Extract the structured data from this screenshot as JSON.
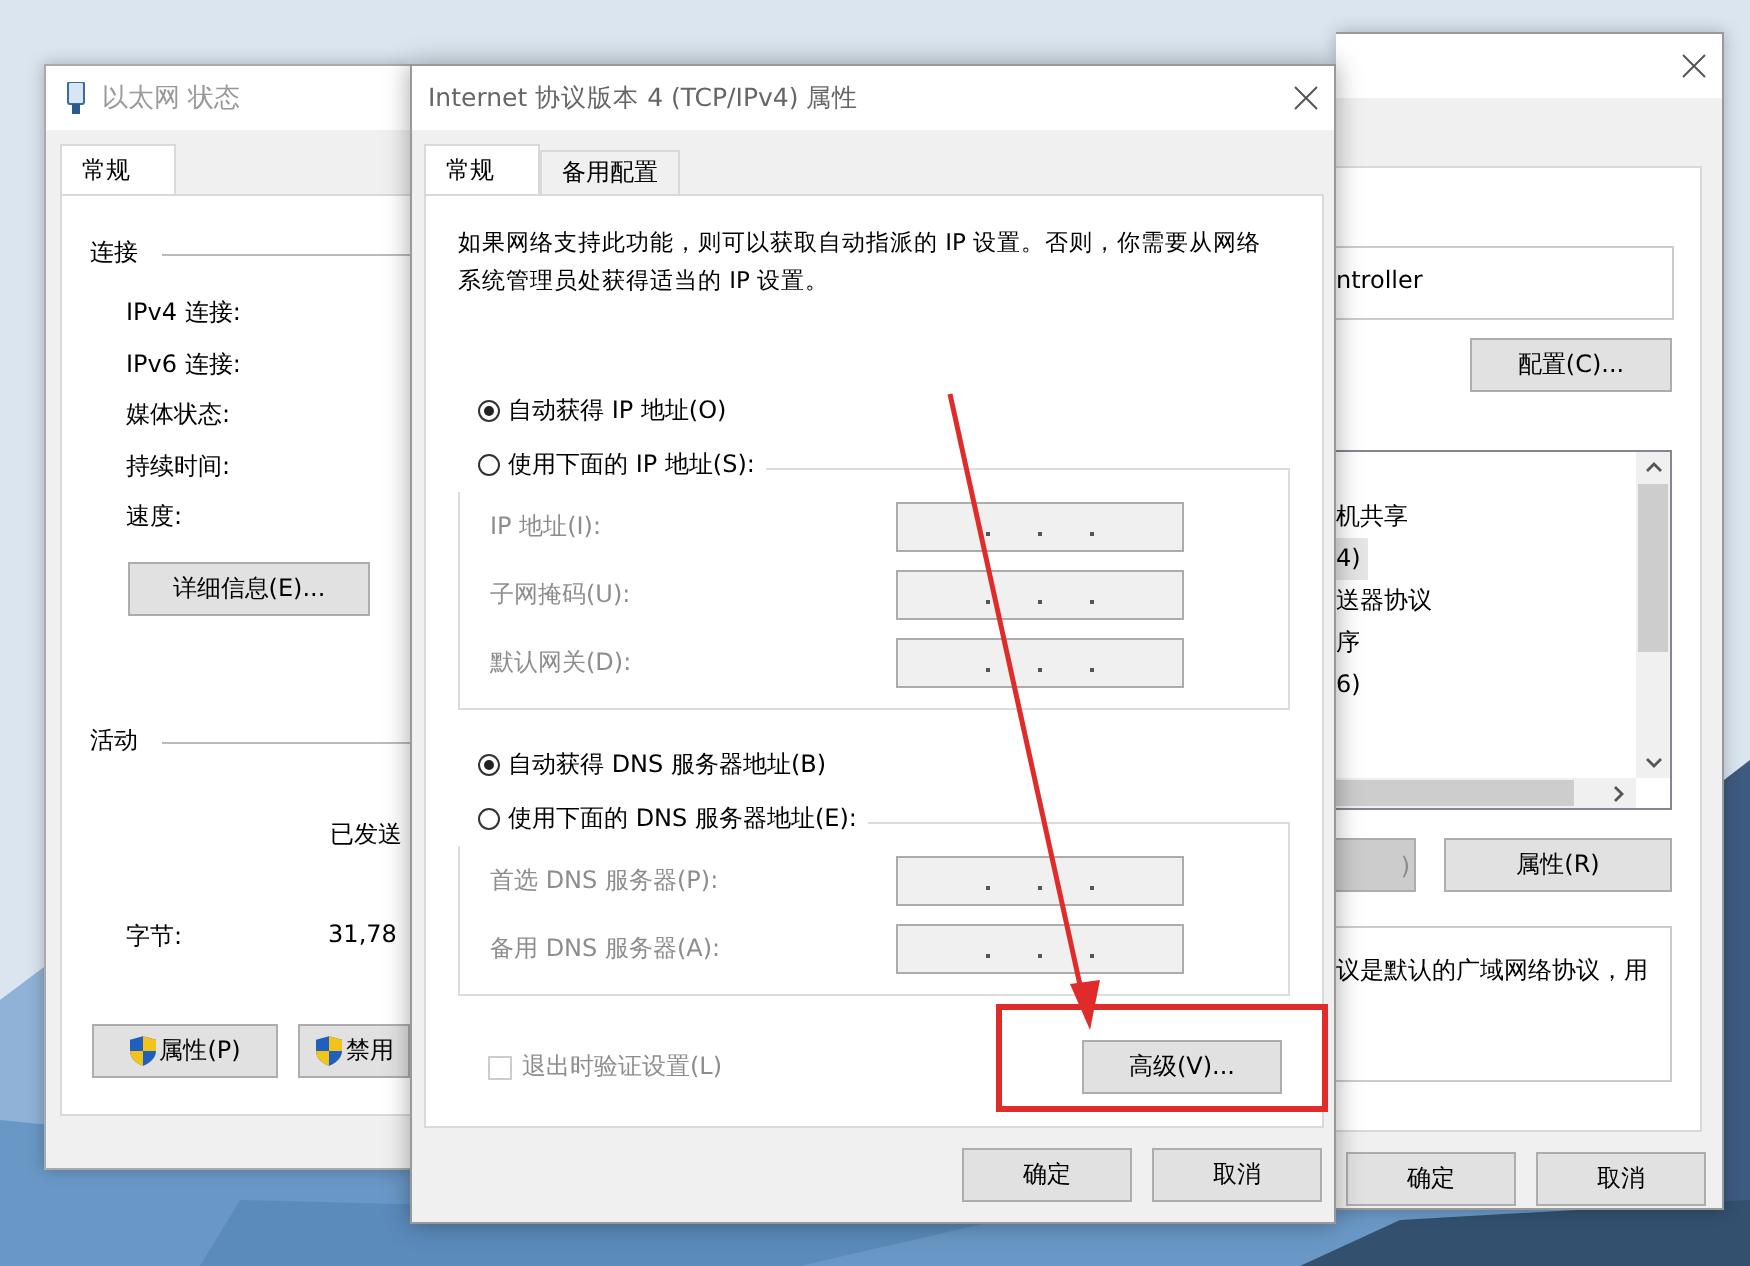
{
  "status_window": {
    "title": "以太网 状态",
    "tabs": [
      {
        "label": "常规",
        "selected": true
      }
    ],
    "connection_heading": "连接",
    "connection_labels": [
      "IPv4 连接:",
      "IPv6 连接:",
      "媒体状态:",
      "持续时间:",
      "速度:"
    ],
    "details_button": "详细信息(E)...",
    "activity_heading": "活动",
    "sent_label": "已发送",
    "bytes_label": "字节:",
    "bytes_sent": "31,78",
    "buttons": [
      "属性(P)",
      "禁用"
    ]
  },
  "ipv4_window": {
    "title": "Internet 协议版本 4 (TCP/IPv4) 属性",
    "tabs": [
      {
        "label": "常规",
        "selected": true
      },
      {
        "label": "备用配置",
        "selected": false
      }
    ],
    "description": "如果网络支持此功能，则可以获取自动指派的 IP 设置。否则，你需要从网络系统管理员处获得适当的 IP 设置。",
    "ip_options": [
      {
        "label": "自动获得 IP 地址(O)",
        "selected": true
      },
      {
        "label": "使用下面的 IP 地址(S):",
        "selected": false
      }
    ],
    "ip_fields": [
      {
        "label": "IP 地址(I):",
        "disabled": true
      },
      {
        "label": "子网掩码(U):",
        "disabled": true
      },
      {
        "label": "默认网关(D):",
        "disabled": true
      }
    ],
    "dns_options": [
      {
        "label": "自动获得 DNS 服务器地址(B)",
        "selected": true
      },
      {
        "label": "使用下面的 DNS 服务器地址(E):",
        "selected": false
      }
    ],
    "dns_fields": [
      {
        "label": "首选 DNS 服务器(P):",
        "disabled": true
      },
      {
        "label": "备用 DNS 服务器(A):",
        "disabled": true
      }
    ],
    "validate_checkbox": {
      "label": "退出时验证设置(L)",
      "checked": false,
      "disabled": true
    },
    "advanced_button": "高级(V)...",
    "buttons": [
      "确定",
      "取消"
    ]
  },
  "properties_window": {
    "adapter": "ntroller",
    "configure_button": "配置(C)...",
    "components": [
      {
        "label": "机共享",
        "selected": false
      },
      {
        "label": "4)",
        "selected": true
      },
      {
        "label": "送器协议",
        "selected": false
      },
      {
        "label": "序",
        "selected": false
      },
      {
        "label": "6)",
        "selected": false
      }
    ],
    "component_buttons": [
      {
        "label": ")",
        "disabled": true
      },
      {
        "label": "属性(R)",
        "disabled": false
      }
    ],
    "description": "议是默认的广域网络协议，用",
    "buttons": [
      "确定",
      "取消"
    ]
  }
}
